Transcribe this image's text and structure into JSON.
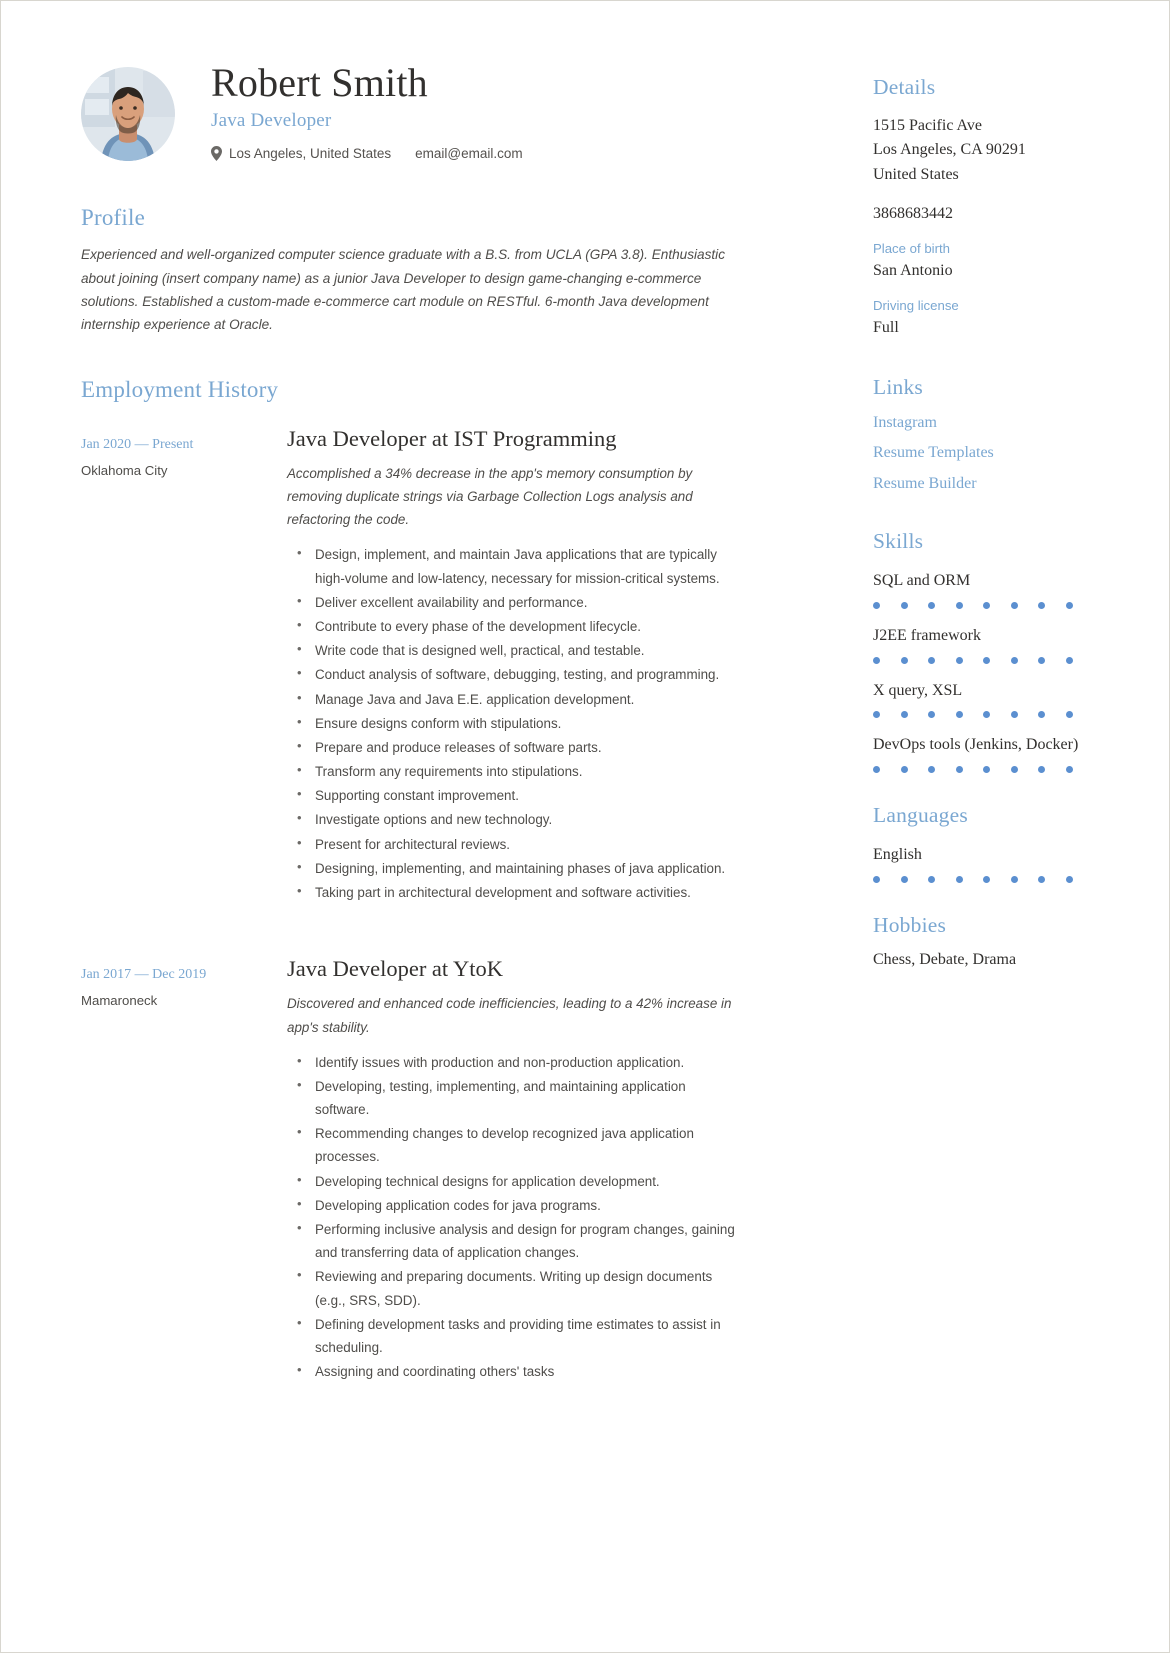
{
  "header": {
    "name": "Robert Smith",
    "job_title": "Java Developer",
    "location": "Los Angeles, United States",
    "email": "email@email.com",
    "location_icon": "map-pin-icon",
    "avatar": "profile-photo"
  },
  "profile": {
    "heading": "Profile",
    "text": "Experienced and well-organized computer science graduate with a B.S. from UCLA (GPA 3.8). Enthusiastic about joining (insert company name) as a junior Java Developer to design game-changing e-commerce solutions. Established a custom-made e-commerce cart module on RESTful. 6-month Java development internship experience at Oracle."
  },
  "employment": {
    "heading": "Employment History",
    "jobs": [
      {
        "date": "Jan 2020 — Present",
        "location": "Oklahoma City",
        "title": "Java Developer at IST Programming",
        "summary": "Accomplished a 34% decrease in the app's memory consumption by removing duplicate strings via Garbage Collection Logs analysis and refactoring the code.",
        "bullets": [
          "Design, implement, and maintain Java applications that are typically high-volume and low-latency, necessary for mission-critical systems.",
          "Deliver excellent availability and performance.",
          "Contribute to every phase of the development lifecycle.",
          "Write code that is designed well, practical, and testable.",
          "Conduct analysis of software, debugging, testing, and programming.",
          "Manage Java and Java E.E. application development.",
          "Ensure designs conform with stipulations.",
          "Prepare and produce releases of software parts.",
          "Transform any requirements into stipulations.",
          "Supporting constant improvement.",
          "Investigate options and new technology.",
          "Present for architectural reviews.",
          "Designing, implementing, and maintaining phases of java application.",
          "Taking part in architectural development and software activities."
        ]
      },
      {
        "date": "Jan 2017 — Dec 2019",
        "location": "Mamaroneck",
        "title": "Java Developer at YtoK",
        "summary": "Discovered and enhanced code inefficiencies, leading to a 42% increase in app's stability.",
        "bullets": [
          "Identify issues with production and non-production application.",
          "Developing, testing, implementing, and maintaining application software.",
          "Recommending changes to develop recognized java application processes.",
          "Developing technical designs for application development.",
          "Developing application codes for java programs.",
          "Performing inclusive analysis and design for program changes, gaining and transferring data of application changes.",
          "Reviewing and preparing documents. Writing up design documents (e.g., SRS, SDD).",
          "Defining development tasks and providing time estimates to assist in scheduling.",
          "Assigning and coordinating others' tasks"
        ]
      }
    ]
  },
  "details": {
    "heading": "Details",
    "address_lines": [
      "1515 Pacific Ave",
      "Los Angeles, CA 90291",
      "United States"
    ],
    "phone": "3868683442",
    "place_of_birth_label": "Place of birth",
    "place_of_birth": "San Antonio",
    "driving_license_label": "Driving license",
    "driving_license": "Full"
  },
  "links": {
    "heading": "Links",
    "items": [
      "Instagram",
      "Resume Templates",
      "Resume Builder"
    ]
  },
  "skills": {
    "heading": "Skills",
    "max_dots": 8,
    "items": [
      {
        "name": "SQL and ORM",
        "level": 8
      },
      {
        "name": "J2EE framework",
        "level": 8
      },
      {
        "name": "X query, XSL",
        "level": 8
      },
      {
        "name": "DevOps tools (Jenkins, Docker)",
        "level": 8
      }
    ]
  },
  "languages": {
    "heading": "Languages",
    "max_dots": 8,
    "items": [
      {
        "name": "English",
        "level": 8
      }
    ]
  },
  "hobbies": {
    "heading": "Hobbies",
    "text": "Chess, Debate, Drama"
  },
  "colors": {
    "accent": "#7aa7d1",
    "dot_filled": "#5b8fd0",
    "dot_empty": "#dfe7f1",
    "text": "#32302e",
    "body_text": "#4f4d4a"
  }
}
